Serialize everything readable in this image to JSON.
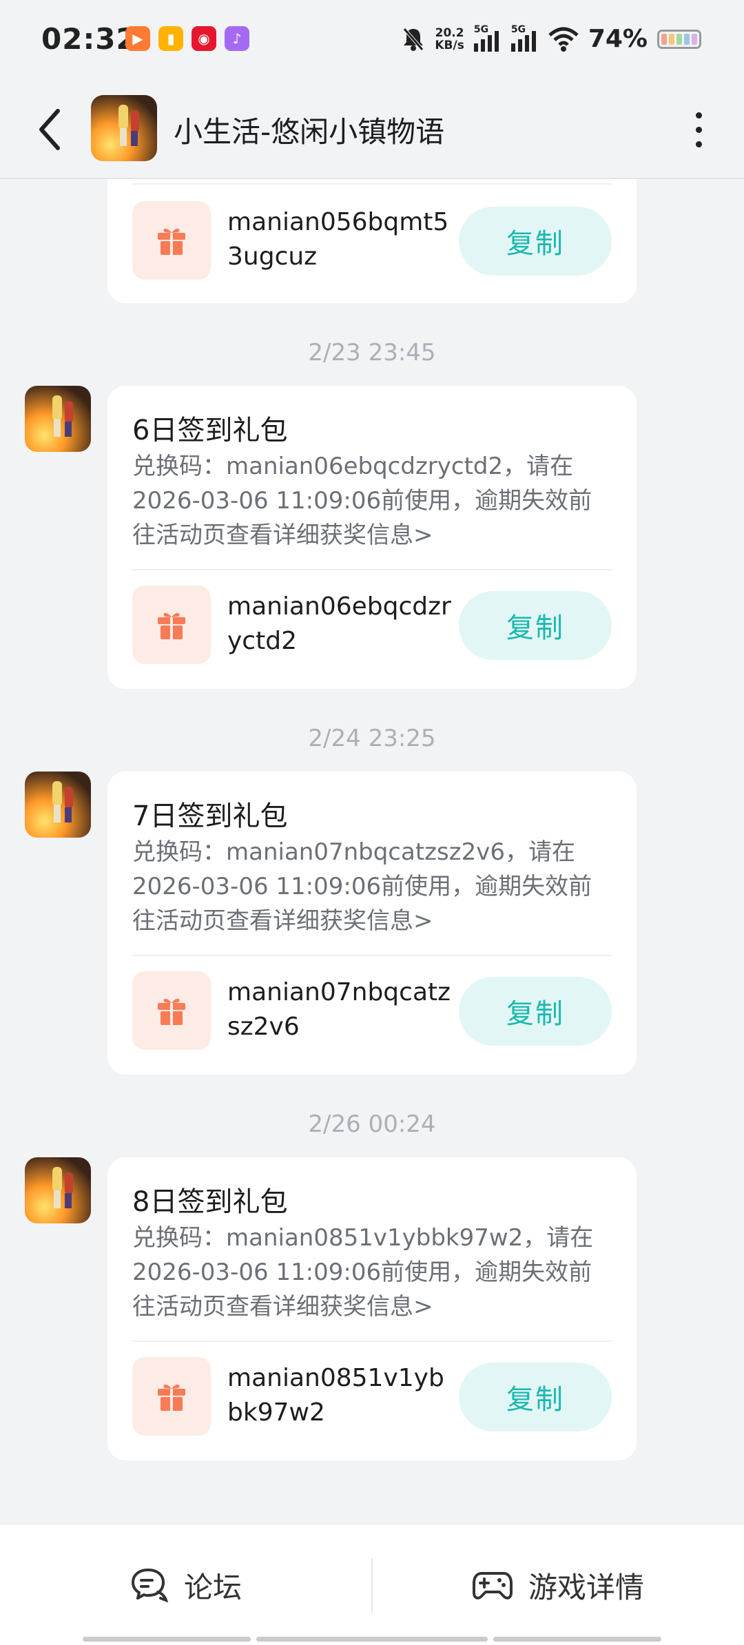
{
  "status_bar": {
    "time": "02:32",
    "net_speed_value": "20.2",
    "net_speed_unit": "KB/s",
    "sim1": "5G",
    "sim2": "5G",
    "battery": "74%"
  },
  "header": {
    "title": "小生活-悠闲小镇物语",
    "back_icon": "chevron-left-icon",
    "more_icon": "more-vertical-icon"
  },
  "partial_card": {
    "code": "manian056bqmt53ugcuz",
    "copy_label": "复制"
  },
  "messages": [
    {
      "date": "2/23  23:45",
      "title": "6日签到礼包",
      "desc": "兑换码：manian06ebqcdzryctd2，请在2026-03-06 11:09:06前使用，逾期失效前往活动页查看详细获奖信息>",
      "code": "manian06ebqcdzryctd2",
      "copy_label": "复制"
    },
    {
      "date": "2/24  23:25",
      "title": "7日签到礼包",
      "desc": "兑换码：manian07nbqcatzsz2v6，请在2026-03-06 11:09:06前使用，逾期失效前往活动页查看详细获奖信息>",
      "code": "manian07nbqcatzsz2v6",
      "copy_label": "复制"
    },
    {
      "date": "2/26  00:24",
      "title": "8日签到礼包",
      "desc": "兑换码：manian0851v1ybbk97w2，请在2026-03-06 11:09:06前使用，逾期失效前往活动页查看详细获奖信息>",
      "code": "manian0851v1ybbk97w2",
      "copy_label": "复制"
    }
  ],
  "bottom_bar": {
    "forum_label": "论坛",
    "game_detail_label": "游戏详情"
  },
  "colors": {
    "accent": "#1ab8b0",
    "copy_bg": "#e2f6f5",
    "gift": "#f97b55",
    "gift_bg": "#fdebe6"
  }
}
